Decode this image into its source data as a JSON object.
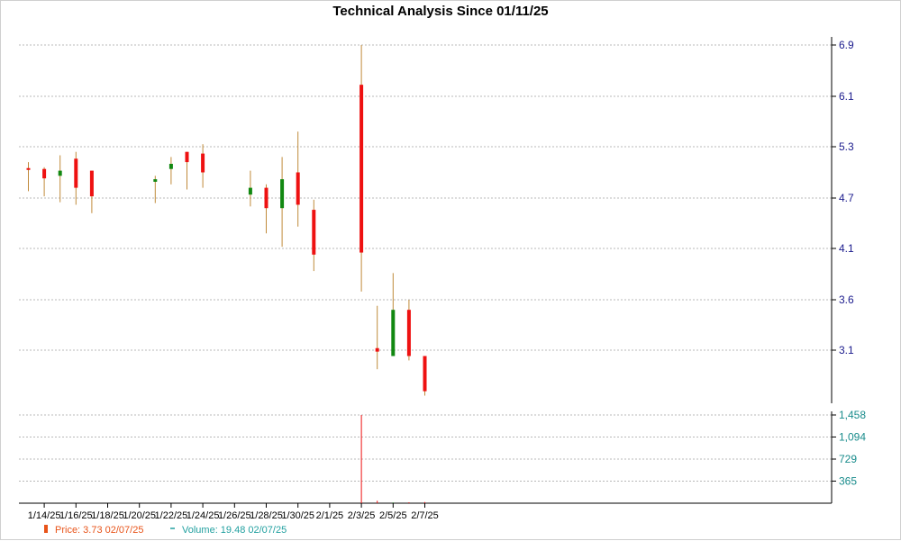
{
  "chart_data": {
    "type": "candlestick",
    "title": "Technical Analysis Since 01/11/25",
    "price_axis": {
      "ticks": [
        "6.9",
        "6.1",
        "5.3",
        "4.7",
        "4.1",
        "3.6",
        "3.1"
      ],
      "tick_values": [
        6.9,
        6.1,
        5.3,
        4.7,
        4.1,
        3.6,
        3.1
      ]
    },
    "volume_axis": {
      "ticks": [
        "1,458",
        "1,094",
        "729",
        "365"
      ],
      "tick_values": [
        1458,
        1094,
        729,
        365
      ]
    },
    "x_ticks": [
      "1/14/25",
      "1/16/25",
      "1/18/25",
      "1/20/25",
      "1/22/25",
      "1/24/25",
      "1/26/25",
      "1/28/25",
      "1/30/25",
      "2/1/25",
      "2/3/25",
      "2/5/25",
      "2/7/25"
    ],
    "candles": [
      {
        "date": "1/13/25",
        "open": 5.05,
        "high": 5.12,
        "low": 4.78,
        "close": 5.04,
        "volume": 0
      },
      {
        "date": "1/14/25",
        "open": 5.04,
        "high": 5.06,
        "low": 4.72,
        "close": 4.93,
        "volume": 0
      },
      {
        "date": "1/15/25",
        "open": 4.96,
        "high": 5.2,
        "low": 4.65,
        "close": 5.02,
        "volume": 0
      },
      {
        "date": "1/16/25",
        "open": 5.16,
        "high": 5.24,
        "low": 4.62,
        "close": 4.82,
        "volume": 0
      },
      {
        "date": "1/17/25",
        "open": 5.02,
        "high": 5.02,
        "low": 4.52,
        "close": 4.72,
        "volume": 0
      },
      {
        "date": "1/21/25",
        "open": 4.89,
        "high": 4.96,
        "low": 4.64,
        "close": 4.92,
        "volume": 0
      },
      {
        "date": "1/22/25",
        "open": 5.04,
        "high": 5.18,
        "low": 4.86,
        "close": 5.1,
        "volume": 0
      },
      {
        "date": "1/23/25",
        "open": 5.24,
        "high": 5.24,
        "low": 4.8,
        "close": 5.12,
        "volume": 0
      },
      {
        "date": "1/24/25",
        "open": 5.22,
        "high": 5.34,
        "low": 4.82,
        "close": 5.0,
        "volume": 0
      },
      {
        "date": "1/27/25",
        "open": 4.74,
        "high": 5.02,
        "low": 4.6,
        "close": 4.82,
        "volume": 0
      },
      {
        "date": "1/28/25",
        "open": 4.82,
        "high": 4.86,
        "low": 4.28,
        "close": 4.58,
        "volume": 0
      },
      {
        "date": "1/29/25",
        "open": 4.58,
        "high": 5.18,
        "low": 4.12,
        "close": 4.92,
        "volume": 0
      },
      {
        "date": "1/30/25",
        "open": 5.0,
        "high": 5.54,
        "low": 4.36,
        "close": 4.62,
        "volume": 0
      },
      {
        "date": "1/31/25",
        "open": 4.56,
        "high": 4.68,
        "low": 3.88,
        "close": 4.04,
        "volume": 0
      },
      {
        "date": "2/3/25",
        "open": 6.28,
        "high": 6.9,
        "low": 3.68,
        "close": 4.06,
        "volume": 1458
      },
      {
        "date": "2/4/25",
        "open": 3.12,
        "high": 3.54,
        "low": 2.84,
        "close": 3.08,
        "volume": 40
      },
      {
        "date": "2/5/25",
        "open": 3.02,
        "high": 3.86,
        "low": 3.02,
        "close": 3.5,
        "volume": 12
      },
      {
        "date": "2/6/25",
        "open": 3.5,
        "high": 3.6,
        "low": 2.96,
        "close": 3.02,
        "volume": 15
      },
      {
        "date": "2/7/25",
        "open": 3.02,
        "high": 3.02,
        "low": 2.48,
        "close": 2.54,
        "volume": 19.48
      }
    ],
    "legend": [
      {
        "label": "Price: 3.73  02/07/25",
        "color": "#e8541a",
        "symbol": "candle"
      },
      {
        "label": "Volume: 19.48  02/07/25",
        "color": "#22a0a0",
        "symbol": "dash"
      }
    ],
    "colors": {
      "up": "#118811",
      "down": "#ee1111",
      "wick": "#c08a3a",
      "grid": "#b8b8b8"
    },
    "grid": true,
    "legend_position": "bottom-left"
  }
}
